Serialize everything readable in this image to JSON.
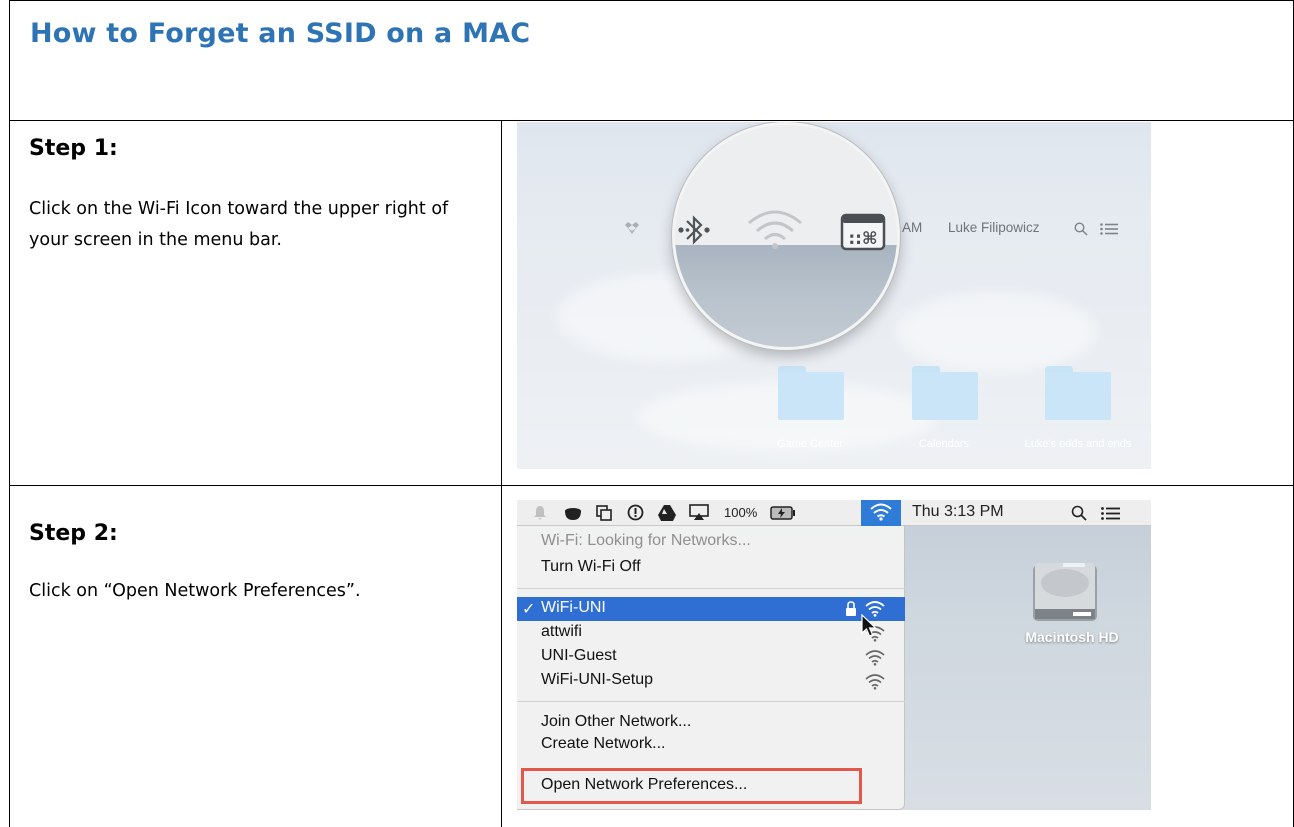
{
  "document": {
    "title": "How to Forget an SSID on a MAC"
  },
  "steps": [
    {
      "heading": "Step 1:",
      "text": "Click on the Wi-Fi Icon toward the upper right of your screen in the menu bar."
    },
    {
      "heading": "Step 2:",
      "text": "Click on “Open Network Preferences”."
    }
  ],
  "screenshot1": {
    "menubar": {
      "time_fragment": "11 AM",
      "user_name": "Luke Filipowicz"
    },
    "desktop_folders": [
      {
        "label": "Game Center"
      },
      {
        "label": "Calendars"
      },
      {
        "label": "Luke's odds and ends"
      }
    ]
  },
  "screenshot2": {
    "menubar": {
      "battery": "100%",
      "clock": "Thu 3:13 PM"
    },
    "wifi_menu": {
      "status": "Wi-Fi: Looking for Networks...",
      "toggle": "Turn Wi-Fi Off",
      "networks": [
        {
          "name": "WiFi-UNI",
          "selected": true,
          "locked": true
        },
        {
          "name": "attwifi",
          "selected": false,
          "locked": false
        },
        {
          "name": "UNI-Guest",
          "selected": false,
          "locked": false
        },
        {
          "name": "WiFi-UNI-Setup",
          "selected": false,
          "locked": false
        }
      ],
      "selected_check": "✓",
      "join_other": "Join Other Network...",
      "create_network": "Create Network...",
      "open_prefs": "Open Network Preferences..."
    },
    "desktop": {
      "drive_label": "Macintosh HD"
    },
    "colors": {
      "selection": "#2f6fd3",
      "callout_box": "#e2584b"
    }
  }
}
